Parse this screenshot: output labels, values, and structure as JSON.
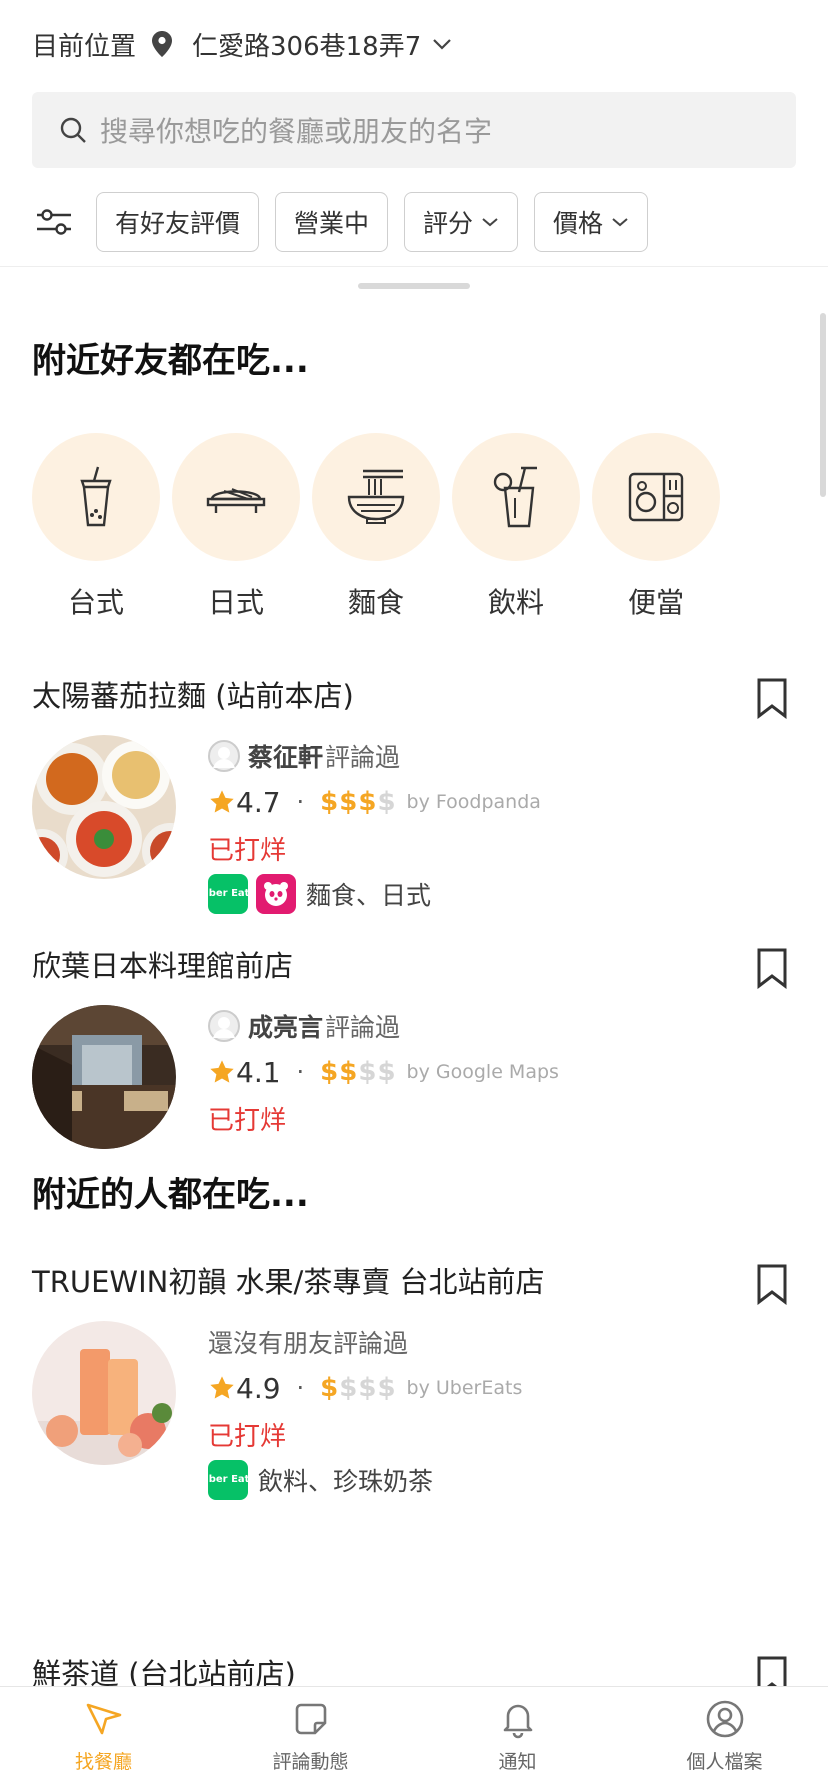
{
  "header": {
    "location_label": "目前位置",
    "address": "仁愛路306巷18弄7",
    "search_placeholder": "搜尋你想吃的餐廳或朋友的名字",
    "filters": [
      "有好友評價",
      "營業中",
      "評分",
      "價格"
    ]
  },
  "sections": {
    "friends_title": "附近好友都在吃...",
    "nearby_title": "附近的人都在吃..."
  },
  "categories": [
    {
      "label": "台式",
      "icon": "bubble-tea-icon"
    },
    {
      "label": "日式",
      "icon": "sushi-icon"
    },
    {
      "label": "麵食",
      "icon": "noodle-bowl-icon"
    },
    {
      "label": "飲料",
      "icon": "drink-icon"
    },
    {
      "label": "便當",
      "icon": "bento-box-icon"
    }
  ],
  "restaurants": [
    {
      "name": "太陽蕃茄拉麵 (站前本店)",
      "reviewer": "蔡征軒",
      "review_suffix": "評論過",
      "rating": "4.7",
      "price_level": 3,
      "price_max": 4,
      "source": "by Foodpanda",
      "status": "已打烊",
      "delivery": [
        "ubereats",
        "foodpanda"
      ],
      "tags": "麵食、日式"
    },
    {
      "name": "欣葉日本料理館前店",
      "reviewer": "成亮言",
      "review_suffix": "評論過",
      "rating": "4.1",
      "price_level": 2,
      "price_max": 4,
      "source": "by Google Maps",
      "status": "已打烊"
    },
    {
      "name": "TRUEWIN初韻 水果/茶專賣 台北站前店",
      "no_friend_text": "還沒有朋友評論過",
      "rating": "4.9",
      "price_level": 1,
      "price_max": 4,
      "source": "by UberEats",
      "status": "已打烊",
      "delivery": [
        "ubereats"
      ],
      "tags": "飲料、珍珠奶茶"
    },
    {
      "name": "鮮茶道 (台北站前店)"
    }
  ],
  "badges": {
    "ubereats_text": "Uber Eats"
  },
  "price_symbol": "$",
  "tabs": [
    {
      "label": "找餐廳",
      "icon": "navigate-arrow-icon",
      "active": true
    },
    {
      "label": "評論動態",
      "icon": "review-note-icon",
      "active": false
    },
    {
      "label": "通知",
      "icon": "bell-icon",
      "active": false
    },
    {
      "label": "個人檔案",
      "icon": "profile-icon",
      "active": false
    }
  ],
  "colors": {
    "accent": "#f5a623",
    "closed": "#e53935",
    "category_bg": "#fdf1e1",
    "ubereats": "#06c167",
    "foodpanda": "#e21b70"
  }
}
